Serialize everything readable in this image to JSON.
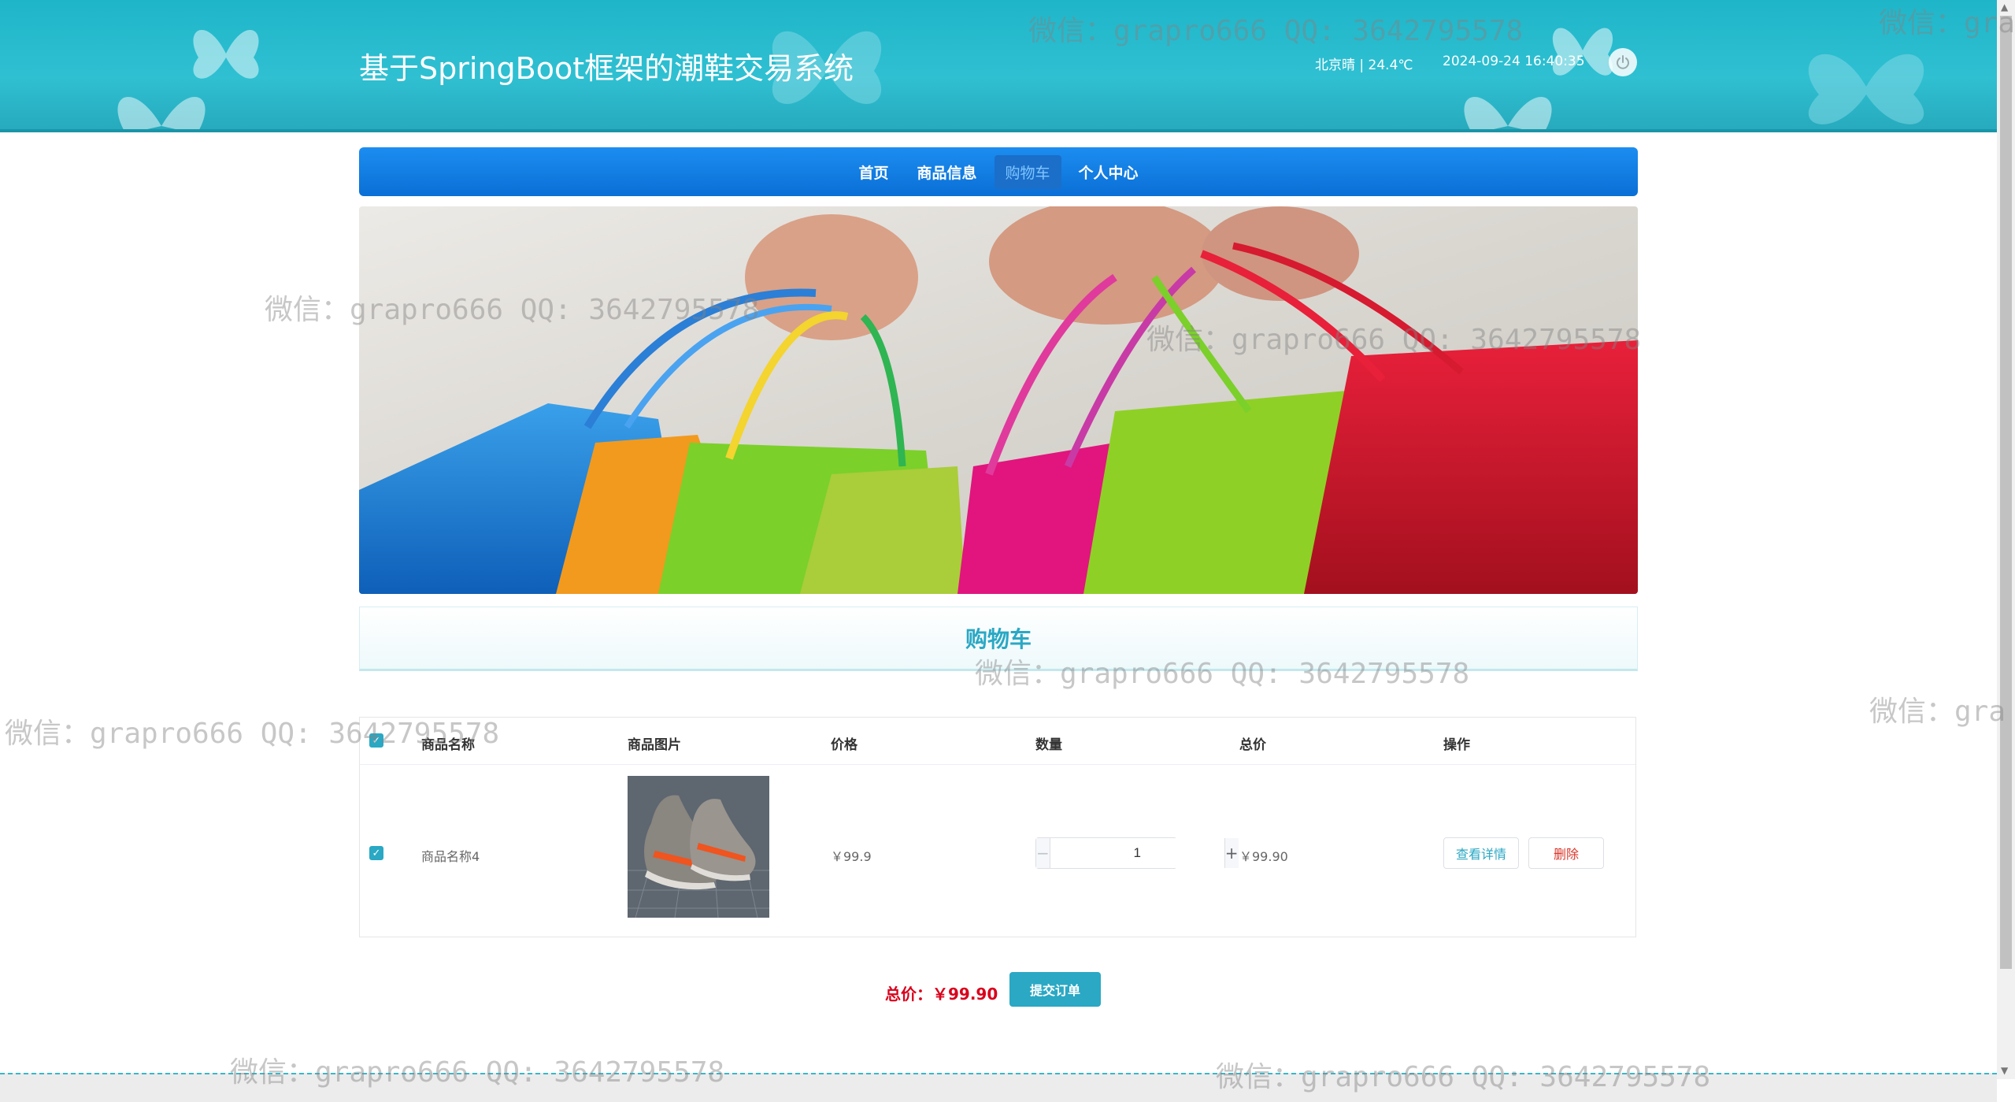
{
  "header": {
    "title": "基于SpringBoot框架的潮鞋交易系统",
    "weather": "北京晴 | 24.4℃",
    "datetime": "2024-09-24  16:40:35"
  },
  "nav": {
    "items": [
      {
        "label": "首页",
        "active": false
      },
      {
        "label": "商品信息",
        "active": false
      },
      {
        "label": "购物车",
        "active": true
      },
      {
        "label": "个人中心",
        "active": false
      }
    ]
  },
  "section": {
    "title": "购物车"
  },
  "table": {
    "columns": [
      "商品名称",
      "商品图片",
      "价格",
      "数量",
      "总价",
      "操作"
    ],
    "rows": [
      {
        "checked": true,
        "name": "商品名称4",
        "price": "￥99.9",
        "quantity": "1",
        "total": "￥99.90",
        "actions": [
          "查看详情",
          "删除"
        ]
      }
    ]
  },
  "footer": {
    "total_label": "总价：￥99.90",
    "submit_label": "提交订单"
  },
  "watermark": {
    "text": "微信：grapro666 QQ: 3642795578",
    "partial": "微信：gra"
  },
  "colors": {
    "header": "#22b6ca",
    "nav": "#0f78e0",
    "accent": "#2aa8c4",
    "danger": "#d9001b"
  }
}
